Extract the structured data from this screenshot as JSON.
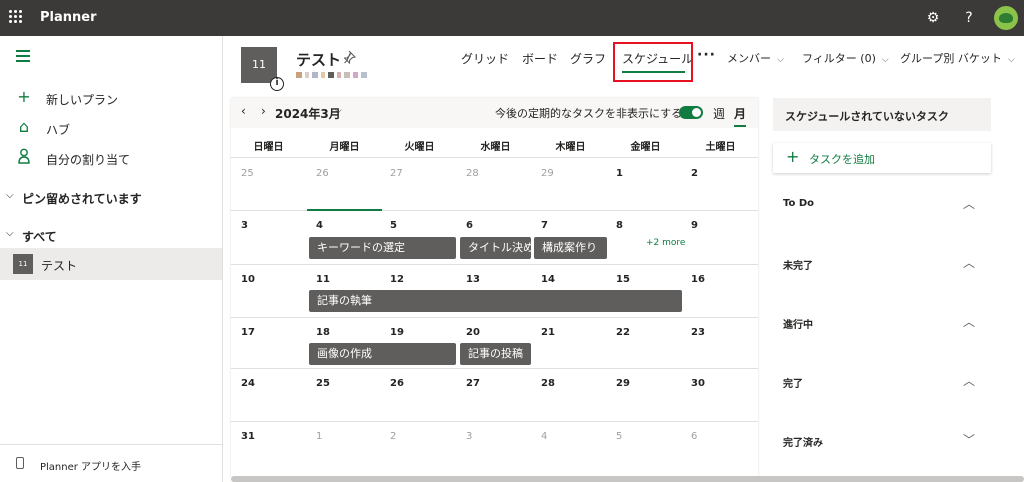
{
  "topbar": {
    "app_title": "Planner",
    "settings_icon": "gear-icon",
    "help_label": "?",
    "colors": {
      "background": "#3b3a39"
    }
  },
  "sidebar": {
    "items": [
      {
        "label": "新しいプラン",
        "icon": "plus-icon"
      },
      {
        "label": "ハブ",
        "icon": "home-icon"
      },
      {
        "label": "自分の割り当て",
        "icon": "person-icon"
      }
    ],
    "pinned_label": "ピン留めされています",
    "all_label": "すべて",
    "plan": {
      "tile": "11",
      "label": "テスト"
    },
    "footer_label": "Planner アプリを入手"
  },
  "header": {
    "plan_tile": "11",
    "info_label": "i",
    "plan_name": "テスト",
    "tabs": [
      {
        "label": "グリッド"
      },
      {
        "label": "ボード"
      },
      {
        "label": "グラフ"
      },
      {
        "label": "スケジュール",
        "active": true
      }
    ],
    "more_label": "···",
    "members_label": "メンバー",
    "filter_label": "フィルター (0)",
    "group_label": "グループ別 バケット"
  },
  "calendar": {
    "month_label": "2024年3月",
    "hide_recurring_label": "今後の定期的なタスクを非表示にする",
    "week_view_label": "週",
    "month_view_label": "月",
    "weekdays": [
      "日曜日",
      "月曜日",
      "火曜日",
      "水曜日",
      "木曜日",
      "金曜日",
      "土曜日"
    ],
    "weeks": [
      [
        "25",
        "26",
        "27",
        "28",
        "29",
        "1",
        "2"
      ],
      [
        "3",
        "4",
        "5",
        "6",
        "7",
        "8",
        "9"
      ],
      [
        "10",
        "11",
        "12",
        "13",
        "14",
        "15",
        "16"
      ],
      [
        "17",
        "18",
        "19",
        "20",
        "21",
        "22",
        "23"
      ],
      [
        "24",
        "25",
        "26",
        "27",
        "28",
        "29",
        "30"
      ],
      [
        "31",
        "1",
        "2",
        "3",
        "4",
        "5",
        "6"
      ]
    ],
    "tasks": {
      "keyword": "キーワードの選定",
      "title": "タイトル決め",
      "structure": "構成案作り",
      "writing": "記事の執筆",
      "image": "画像の作成",
      "posting": "記事の投稿"
    },
    "more_link": "+2 more"
  },
  "unscheduled": {
    "title": "スケジュールされていないタスク",
    "add_task_label": "タスクを追加",
    "buckets": [
      {
        "label": "To Do"
      },
      {
        "label": "未完了"
      },
      {
        "label": "進行中"
      },
      {
        "label": "完了"
      },
      {
        "label": "完了済み"
      }
    ]
  },
  "colors": {
    "accent": "#107c41",
    "task_bar": "#605e5c",
    "highlight": "#e81123"
  }
}
